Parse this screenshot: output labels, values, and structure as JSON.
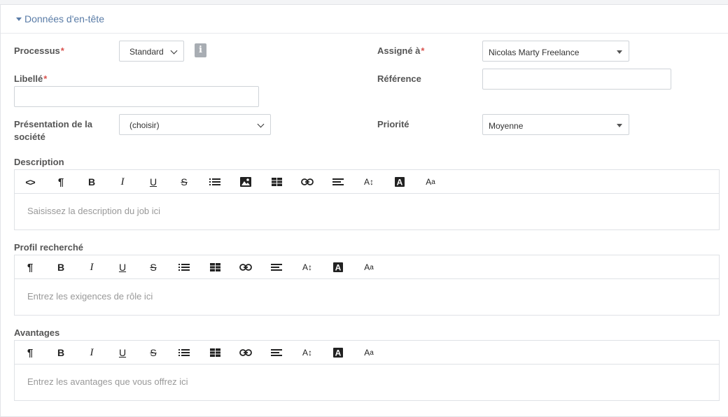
{
  "section": {
    "title": "Données d'en-tête"
  },
  "form": {
    "processus": {
      "label": "Processus",
      "required": "*",
      "value": "Standard"
    },
    "assigne": {
      "label": "Assigné à",
      "required": "*",
      "value": "Nicolas Marty Freelance"
    },
    "libelle": {
      "label": "Libellé",
      "required": "*",
      "value": ""
    },
    "reference": {
      "label": "Référence",
      "value": ""
    },
    "presentation": {
      "label_line1": "Présentation de la",
      "label_line2": "société",
      "value": "(choisir)"
    },
    "priorite": {
      "label": "Priorité",
      "value": "Moyenne"
    }
  },
  "editors": {
    "description": {
      "label": "Description",
      "placeholder": "Saisissez la description du job ici"
    },
    "profil": {
      "label": "Profil recherché",
      "placeholder": "Entrez les exigences de rôle ici"
    },
    "avantages": {
      "label": "Avantages",
      "placeholder": "Entrez les avantages que vous offrez ici"
    }
  },
  "toolbar_glyphs": {
    "code": "<>",
    "paragraph": "¶",
    "bold": "B",
    "italic": "I",
    "underline": "U",
    "strike": "S",
    "fontsize": "A↕",
    "aa_big": "A",
    "aa_small": "a",
    "highlight": "A"
  },
  "colors": {
    "accent": "#5a7ca7",
    "required": "#d9534f"
  }
}
